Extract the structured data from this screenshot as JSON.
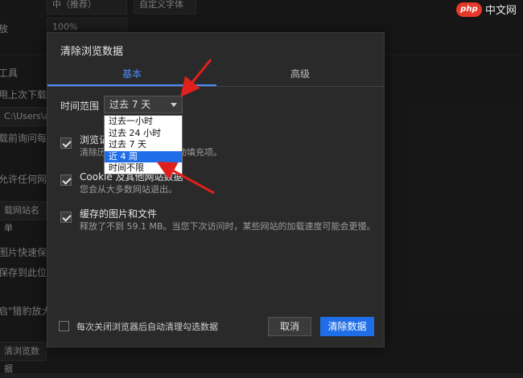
{
  "background": {
    "top_select_1": "中（推荐）",
    "top_button": "自定义字体",
    "zoom_label": "放",
    "zoom_value": "100%",
    "tools_label": "工具",
    "last_download": "用上次下载目",
    "path_text": "C:\\Users\\adm",
    "ask_text": "载前询问每个",
    "allow_sites": "允许任何网站",
    "site_list": "载网站名单",
    "image_quick_save": "图片快速保",
    "save_to_location": "保存到此位置",
    "cat_zoom": "启\"猎豹放大镜",
    "clear_browsing_data": "清浏览数据"
  },
  "dialog": {
    "title": "清除浏览数据",
    "tabs": [
      "基本",
      "高级"
    ],
    "range_label": "时间范围",
    "range_selected": "过去 7 天",
    "dropdown_options": [
      "过去一小时",
      "过去 24 小时",
      "过去 7 天",
      "近 4 周",
      "时间不限"
    ],
    "dropdown_highlighted_index": 3,
    "options": [
      {
        "title": "浏览记",
        "desc_prefix": "清除历",
        "desc_suffix": "自动填充项。",
        "checked": true
      },
      {
        "title": "Cookie 及其他网站数据",
        "desc": "您会从大多数网站退出。",
        "checked": true
      },
      {
        "title": "缓存的图片和文件",
        "desc": "释放了不到 59.1 MB。当您下次访问时，某些网站的加载速度可能会更慢。",
        "checked": true
      }
    ],
    "auto_clear_label": "每次关闭浏览器后自动清理勾选数据",
    "cancel_label": "取消",
    "clear_label": "清除数据"
  },
  "watermark": {
    "logo": "php",
    "text": "中文网"
  },
  "colors": {
    "accent": "#1f6ee8",
    "tab_active": "#4c8dff",
    "arrow": "#e0201c"
  }
}
